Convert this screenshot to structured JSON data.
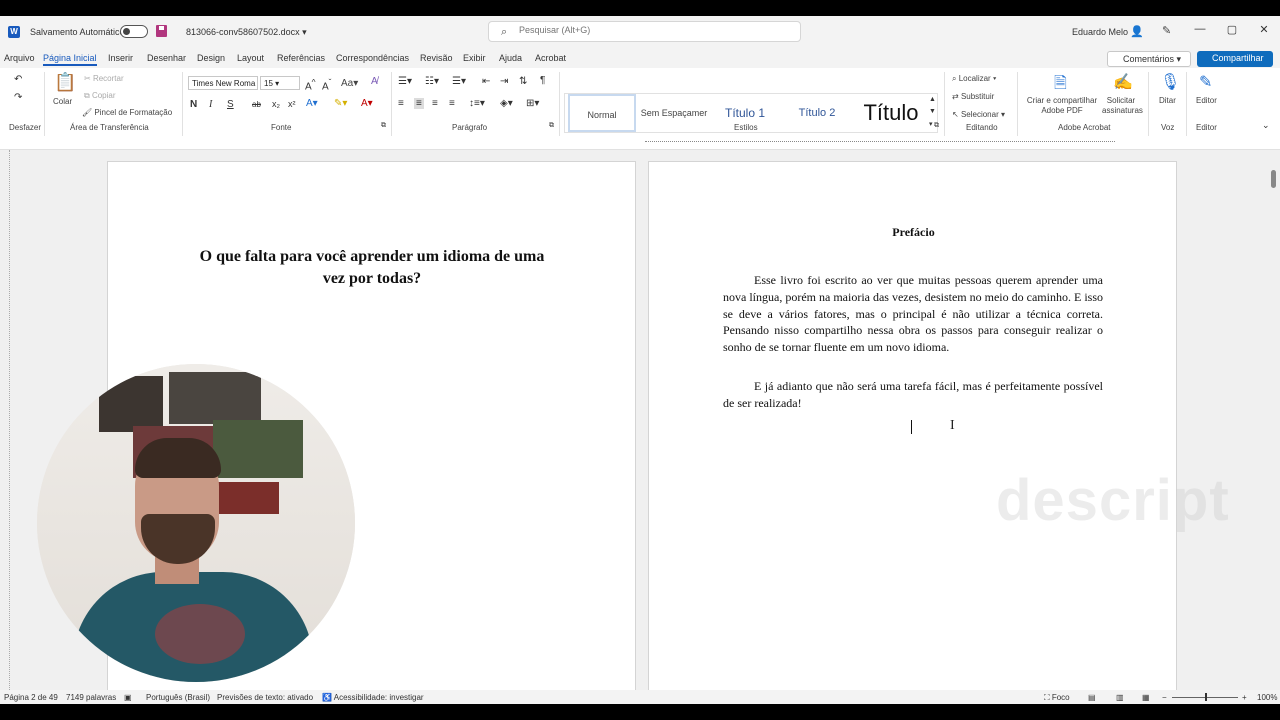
{
  "titlebar": {
    "autosave_label": "Salvamento Automático",
    "filename": "813066-conv58607502.docx",
    "search_placeholder": "Pesquisar (Alt+G)",
    "user_name": "Eduardo Melo"
  },
  "menu": {
    "tabs": [
      "Arquivo",
      "Página Inicial",
      "Inserir",
      "Desenhar",
      "Design",
      "Layout",
      "Referências",
      "Correspondências",
      "Revisão",
      "Exibir",
      "Ajuda",
      "Acrobat"
    ],
    "active_tab": "Página Inicial",
    "comments_label": "Comentários",
    "share_label": "Compartilhar"
  },
  "ribbon": {
    "undo_group": "Desfazer",
    "paste_label": "Colar",
    "cut_label": "Recortar",
    "copy_label": "Copiar",
    "format_painter_label": "Pincel de Formatação",
    "clipboard_group": "Área de Transferência",
    "font_name": "Times New Roma",
    "font_size": "15",
    "case_label": "Aa",
    "font_group": "Fonte",
    "bold": "N",
    "italic": "I",
    "underline": "S",
    "strike": "ab",
    "subscript": "x₂",
    "superscript": "x²",
    "paragraph_group": "Parágrafo",
    "styles": [
      "Normal",
      "Sem Espaçamer",
      "Título 1",
      "Título 2",
      "Título"
    ],
    "styles_group": "Estilos",
    "find_label": "Localizar",
    "replace_label": "Substituir",
    "select_label": "Selecionar",
    "editing_group": "Editando",
    "adobe_create_label": "Criar e compartilhar Adobe PDF",
    "adobe_sign_label": "Solicitar assinaturas",
    "adobe_group": "Adobe Acrobat",
    "dictate_label": "Ditar",
    "voice_group": "Voz",
    "editor_label": "Editor",
    "editor_group": "Editor"
  },
  "document": {
    "left_page_title": "O que falta para você aprender um idioma de uma vez por todas?",
    "preface_heading": "Prefácio",
    "paragraph1": "Esse livro foi escrito ao ver que muitas pessoas querem aprender uma nova língua, porém na maioria das vezes, desistem no meio do caminho. E isso se deve a vários fatores, mas o principal é não utilizar a técnica correta. Pensando nisso compartilho nessa obra os passos para conseguir realizar o sonho de se tornar fluente em um novo idioma.",
    "paragraph2": "E já adianto que não será uma tarefa fácil, mas é perfeitamente possível de ser realizada!"
  },
  "watermark": "descript",
  "statusbar": {
    "page": "Página 2 de 49",
    "words": "7149 palavras",
    "language": "Português (Brasil)",
    "predictions": "Previsões de texto: ativado",
    "accessibility": "Acessibilidade: investigar",
    "focus": "Foco",
    "zoom": "100%"
  }
}
